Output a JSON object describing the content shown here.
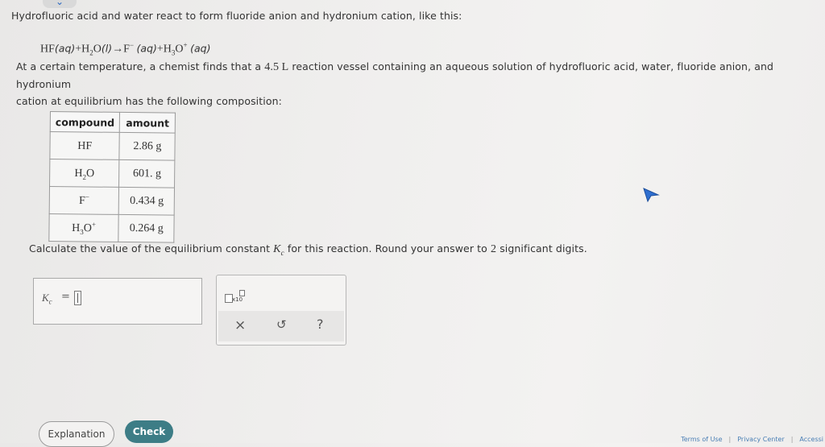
{
  "intro": "Hydrofluoric acid and water react to form fluoride anion and hydronium cation, like this:",
  "equation": {
    "r1": "HF",
    "r1_state": "(aq)",
    "plus1": "+",
    "r2_a": "H",
    "r2_sub": "2",
    "r2_b": "O",
    "r2_state": "(l)",
    "arrow": "→",
    "p1": "F",
    "p1_sup": "−",
    "p1_state": "(aq)",
    "plus2": "+",
    "p2_a": "H",
    "p2_sub": "3",
    "p2_b": "O",
    "p2_sup": "+",
    "p2_state": "(aq)"
  },
  "condition": {
    "pre": "At a certain temperature, a chemist finds that a",
    "volume": "4.5 L",
    "post_line1": "reaction vessel containing an aqueous solution of hydrofluoric acid, water, fluoride anion, and hydronium",
    "line2": "cation at equilibrium has the following composition:"
  },
  "table": {
    "headers": [
      "compound",
      "amount"
    ],
    "rows": [
      {
        "c_main": "HF",
        "c_sub": "",
        "c_tail": "",
        "c_sup": "",
        "amount": "2.86 g"
      },
      {
        "c_main": "H",
        "c_sub": "2",
        "c_tail": "O",
        "c_sup": "",
        "amount": "601. g"
      },
      {
        "c_main": "F",
        "c_sub": "",
        "c_tail": "",
        "c_sup": "−",
        "amount": "0.434 g"
      },
      {
        "c_main": "H",
        "c_sub": "3",
        "c_tail": "O",
        "c_sup": "+",
        "amount": "0.264 g"
      }
    ]
  },
  "question": {
    "pre": "Calculate the value of the equilibrium constant",
    "k": "K",
    "k_sub": "c",
    "post": "for this reaction. Round your answer to",
    "digits": "2",
    "end": "significant digits."
  },
  "answer": {
    "k": "K",
    "k_sub": "c",
    "eq": "="
  },
  "tools": {
    "x10_label": "x10",
    "clear": "×",
    "undo": "↺",
    "help": "?"
  },
  "buttons": {
    "explanation": "Explanation",
    "check": "Check"
  },
  "footer": {
    "terms": "Terms of Use",
    "privacy": "Privacy Center",
    "access": "Accessi"
  },
  "colors": {
    "check_bg": "#3d7d86",
    "link": "#4a7fb5",
    "chevron": "#2a67c2"
  }
}
